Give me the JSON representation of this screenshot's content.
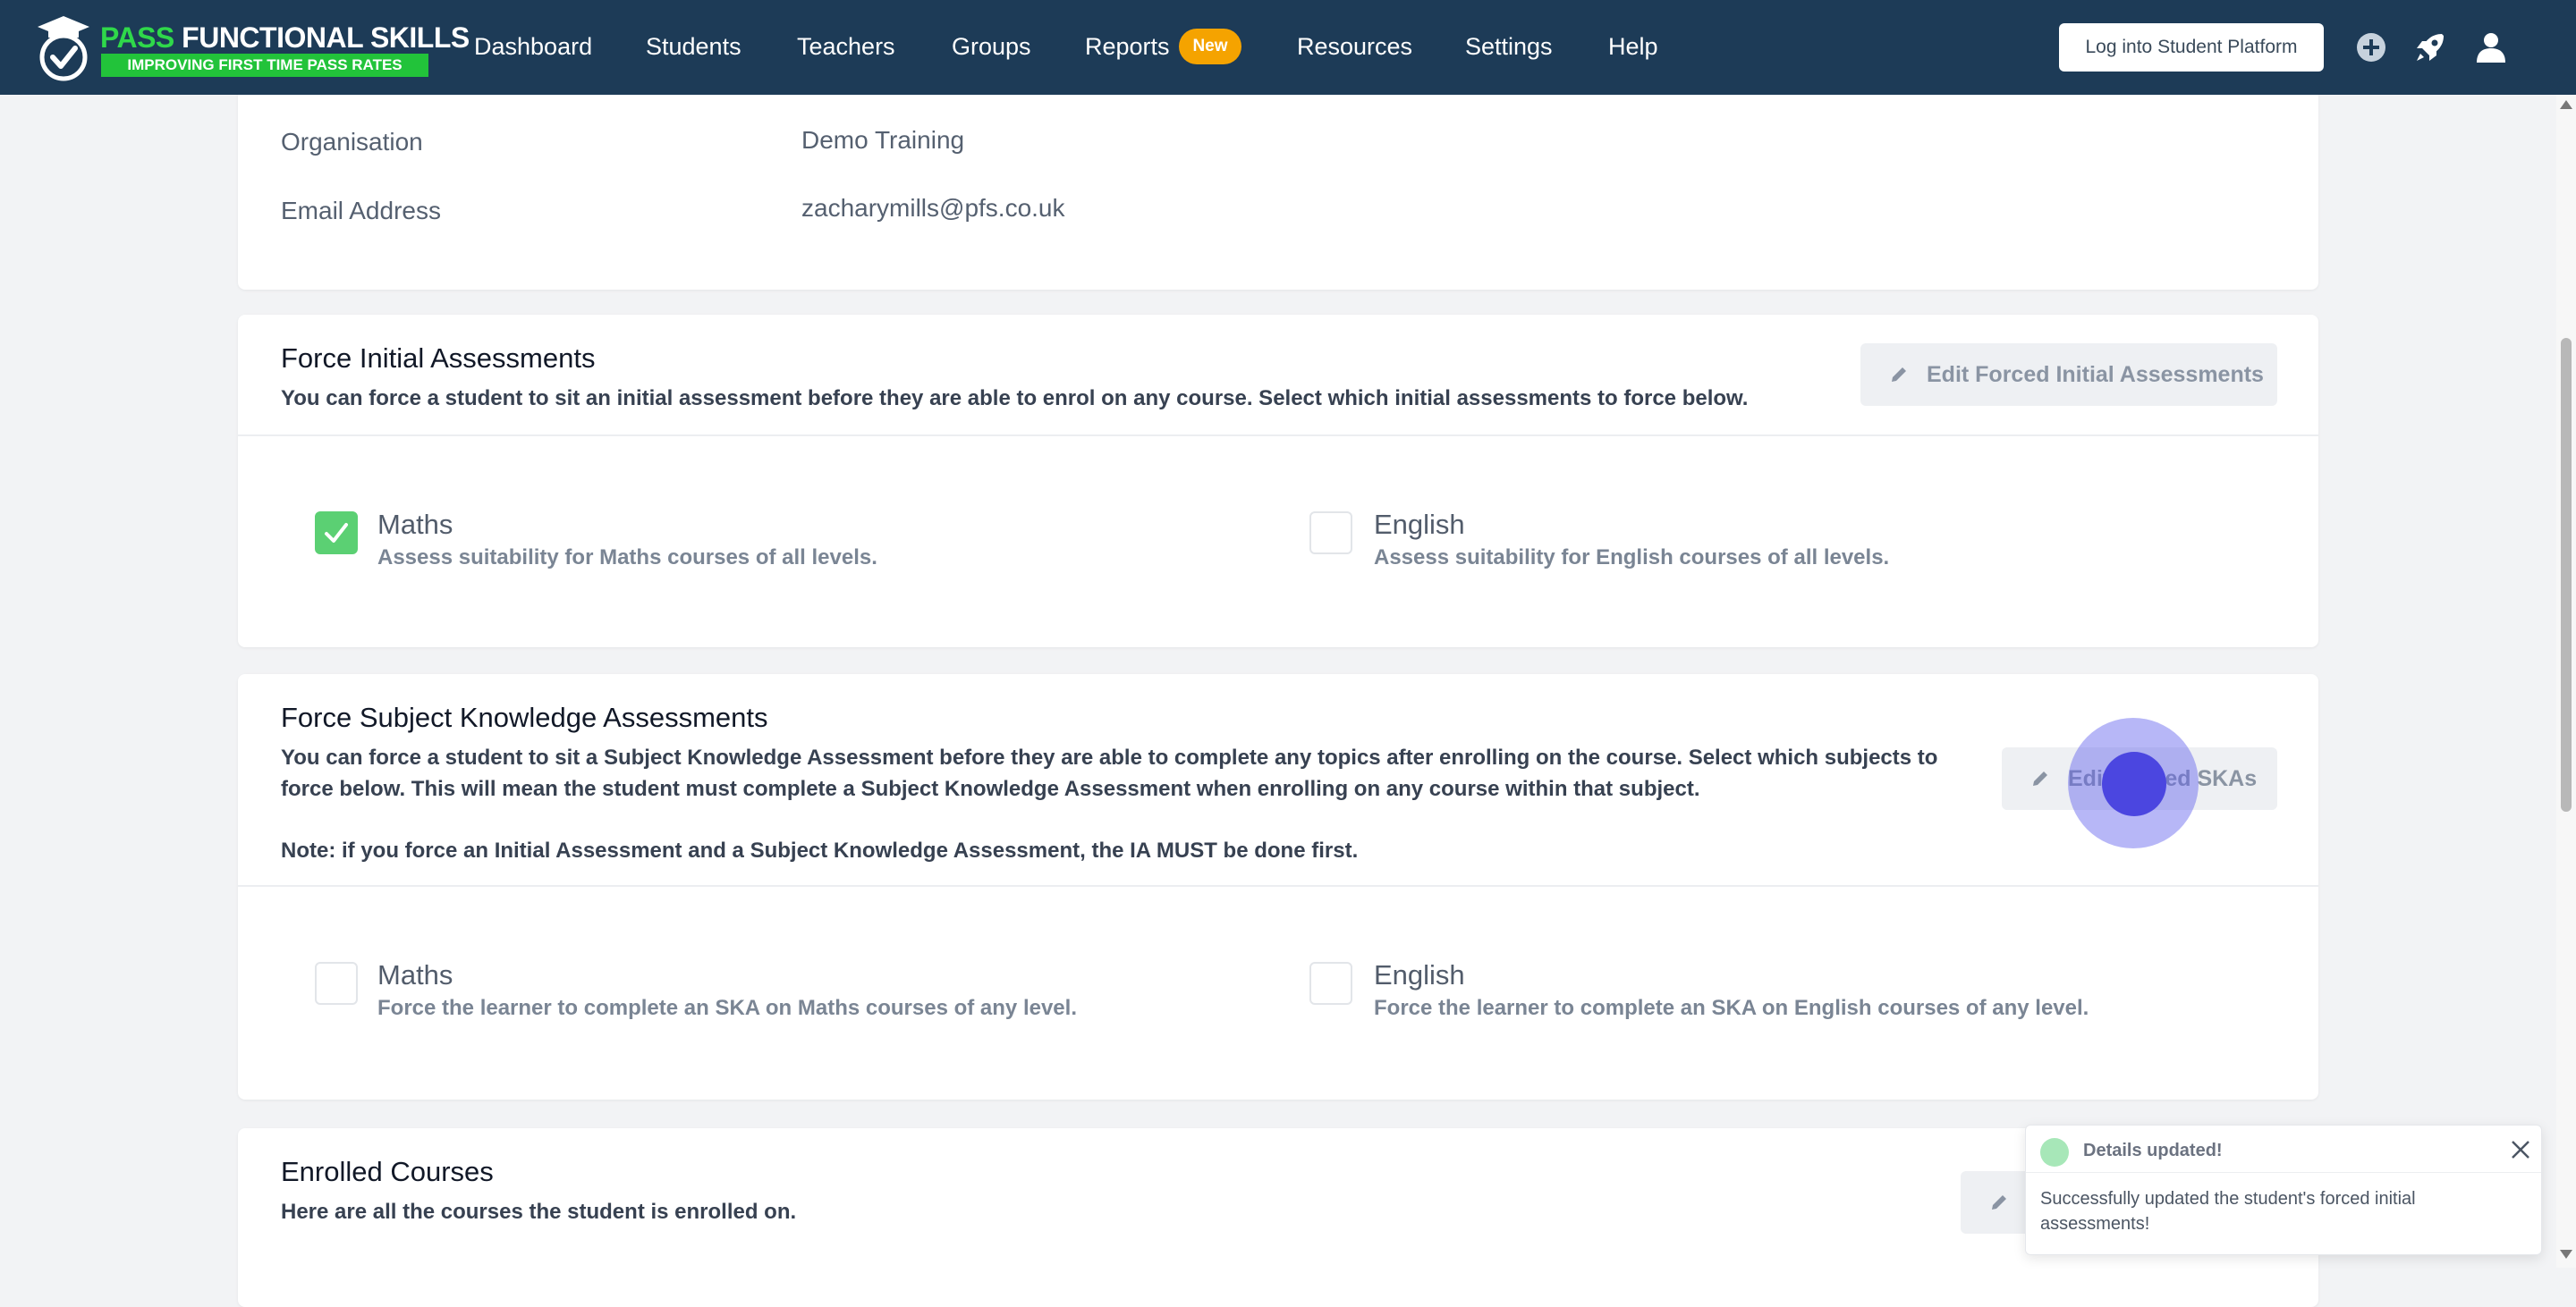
{
  "brand": {
    "title_part1": "PASS",
    "title_part2": " FUNCTIONAL SKILLS",
    "tagline": "IMPROVING FIRST TIME PASS RATES"
  },
  "nav": {
    "items": [
      {
        "label": "Dashboard"
      },
      {
        "label": "Students"
      },
      {
        "label": "Teachers"
      },
      {
        "label": "Groups"
      },
      {
        "label": "Reports",
        "badge": "New"
      },
      {
        "label": "Resources"
      },
      {
        "label": "Settings"
      },
      {
        "label": "Help"
      }
    ],
    "login_button": "Log into Student Platform",
    "icons": [
      "plus-circle-icon",
      "rocket-icon",
      "user-icon"
    ]
  },
  "details": {
    "organisation_label": "Organisation",
    "organisation_value": "Demo Training",
    "email_label": "Email Address",
    "email_value": "zacharymills@pfs.co.uk"
  },
  "initial_assessments": {
    "title": "Force Initial Assessments",
    "description": "You can force a student to sit an initial assessment before they are able to enrol on any course. Select which initial assessments to force below.",
    "edit_button": "Edit Forced Initial Assessments",
    "options": [
      {
        "title": "Maths",
        "description": "Assess suitability for Maths courses of all levels.",
        "checked": true
      },
      {
        "title": "English",
        "description": "Assess suitability for English courses of all levels.",
        "checked": false
      }
    ]
  },
  "ska": {
    "title": "Force Subject Knowledge Assessments",
    "description_line1": "You can force a student to sit a Subject Knowledge Assessment before they are able to complete any topics after enrolling on the course. Select which subjects to",
    "description_line2": "force below. This will mean the student must complete a Subject Knowledge Assessment when enrolling on any course within that subject.",
    "note": "Note: if you force an Initial Assessment and a Subject Knowledge Assessment, the IA MUST be done first.",
    "edit_button": "Edit Forced SKAs",
    "options": [
      {
        "title": "Maths",
        "description": "Force the learner to complete an SKA on Maths courses of any level.",
        "checked": false
      },
      {
        "title": "English",
        "description": "Force the learner to complete an SKA on English courses of any level.",
        "checked": false
      }
    ]
  },
  "enrolled": {
    "title": "Enrolled Courses",
    "description": "Here are all the courses the student is enrolled on."
  },
  "toast": {
    "title": "Details updated!",
    "message": "Successfully updated the student's forced initial assessments!"
  },
  "colors": {
    "navbar": "#1d3b57",
    "brand_green": "#22c33a",
    "badge": "#f5a300",
    "checked": "#5bd073",
    "click_indicator": "#4b46e0"
  }
}
